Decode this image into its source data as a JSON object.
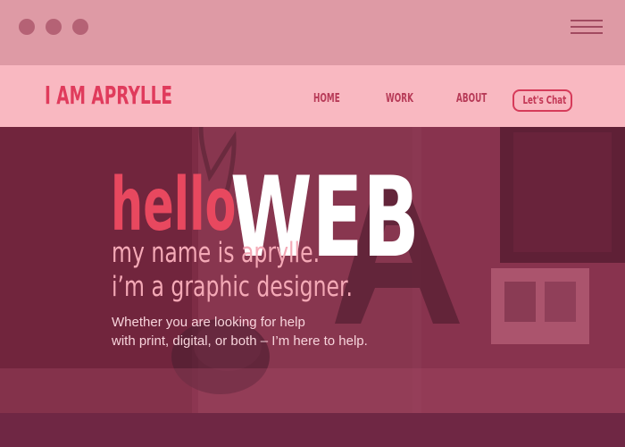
{
  "window": {
    "dots": [
      "close-dot",
      "minimize-dot",
      "maximize-dot"
    ],
    "menu_icon": "hamburger-menu-icon"
  },
  "site": {
    "logo": "I AM APRYLLE",
    "nav": {
      "home": "HOME",
      "work": "WORK",
      "about": "ABOUT",
      "cta": "Let's Chat"
    }
  },
  "hero": {
    "hello": "hello.",
    "overlay_word": "WEB",
    "line1": "my name is aprylle.",
    "line2": "i’m a graphic designer.",
    "help_line1": "Whether you are looking for help",
    "help_line2": "with print, digital, or both – I’m here to help."
  },
  "colors": {
    "titlebar": "#de9aa5",
    "navbar": "#f9b8c1",
    "accent": "#e03b5c",
    "hero_text": "#f4a9b6",
    "hero_bg": "#84314c",
    "footer": "#6f2744"
  }
}
